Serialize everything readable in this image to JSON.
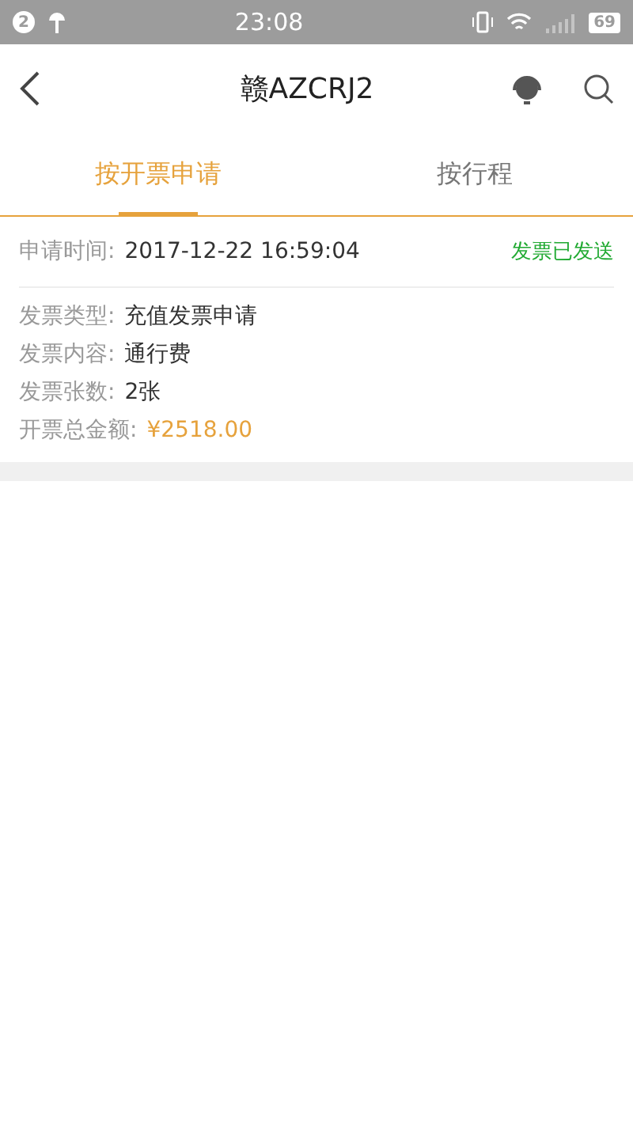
{
  "status_bar": {
    "notification_count": "2",
    "time": "23:08",
    "battery": "69"
  },
  "header": {
    "title": "赣AZCRJ2"
  },
  "tabs": [
    {
      "label": "按开票申请",
      "selected": true
    },
    {
      "label": "按行程",
      "selected": false
    }
  ],
  "invoices": [
    {
      "time_label": "申请时间:",
      "time": "2017-12-22 16:59:04",
      "status": "发票已发送",
      "color": "#22aa33",
      "details": [
        {
          "label": "发票类型:",
          "value": "充值发票申请",
          "kind": "text"
        },
        {
          "label": "发票内容:",
          "value": "通行费",
          "kind": "text"
        },
        {
          "label": "发票张数:",
          "value": "2张",
          "kind": "text"
        },
        {
          "label": "开票总金额:",
          "value": "¥2518.00",
          "kind": "amount"
        }
      ]
    }
  ]
}
